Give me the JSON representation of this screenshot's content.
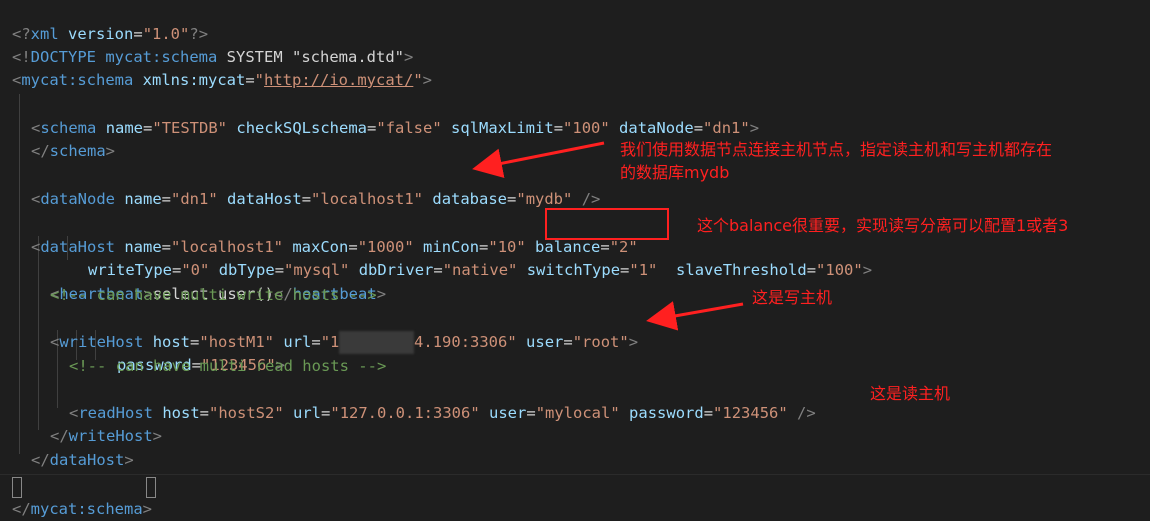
{
  "lines": {
    "l1": {
      "open": "<?",
      "name": "xml",
      "attr": "version",
      "eq": "=",
      "val": "\"1.0\"",
      "close": "?>"
    },
    "l2": {
      "open": "<!",
      "kw": "DOCTYPE",
      "name": "mycat:schema",
      "sys": "SYSTEM",
      "dtd": "\"schema.dtd\"",
      "close": ">"
    },
    "l3": {
      "open": "<",
      "name": "mycat:schema",
      "attr": "xmlns:mycat",
      "eq": "=",
      "q1": "\"",
      "url": "http://io.mycat/",
      "q2": "\"",
      "close": ">"
    },
    "schema_open": {
      "open": "<",
      "name": "schema",
      "a1": "name",
      "v1": "\"TESTDB\"",
      "a2": "checkSQLschema",
      "v2": "\"false\"",
      "a3": "sqlMaxLimit",
      "v3": "\"100\"",
      "a4": "dataNode",
      "v4": "\"dn1\"",
      "close": ">"
    },
    "schema_close": {
      "open": "</",
      "name": "schema",
      "close": ">"
    },
    "datanode": {
      "open": "<",
      "name": "dataNode",
      "a1": "name",
      "v1": "\"dn1\"",
      "a2": "dataHost",
      "v2": "\"localhost1\"",
      "a3": "database",
      "v3": "\"mydb\"",
      "close": "/>"
    },
    "datahost": {
      "open": "<",
      "name": "dataHost",
      "a1": "name",
      "v1": "\"localhost1\"",
      "a2": "maxCon",
      "v2": "\"1000\"",
      "a3": "minCon",
      "v3": "\"10\"",
      "a4": "balance",
      "v4": "\"2\""
    },
    "datahost2": {
      "a1": "writeType",
      "v1": "\"0\"",
      "a2": "dbType",
      "v2": "\"mysql\"",
      "a3": "dbDriver",
      "v3": "\"native\"",
      "a4": "switchType",
      "v4": "\"1\"",
      "a5": "slaveThreshold",
      "v5": "\"100\"",
      "close": ">"
    },
    "heartbeat": {
      "open": "<",
      "name": "heartbeat",
      "close": ">",
      "text": "select user()",
      "open2": "</",
      "name2": "heartbeat",
      "close2": ">"
    },
    "comment1": "<!-- can have multi write hosts -->",
    "writehost": {
      "open": "<",
      "name": "writeHost",
      "a1": "host",
      "v1": "\"hostM1\"",
      "a2": "url",
      "v2a": "\"1",
      "v2b": "4.190:3306\"",
      "a3": "user",
      "v3": "\"root\"",
      "close": ">"
    },
    "password": {
      "a1": "password",
      "v1": "\"123456\"",
      "close": ">"
    },
    "comment2": "<!-- can have multi read hosts -->",
    "readhost": {
      "open": "<",
      "name": "readHost",
      "a1": "host",
      "v1": "\"hostS2\"",
      "a2": "url",
      "v2": "\"127.0.0.1:3306\"",
      "a3": "user",
      "v3": "\"mylocal\"",
      "a4": "password",
      "v4": "\"123456\"",
      "close": "/>"
    },
    "writehost_close": {
      "open": "</",
      "name": "writeHost",
      "close": ">"
    },
    "datahost_close": {
      "open": "</",
      "name": "dataHost",
      "close": ">"
    },
    "mycat_close": {
      "open": "</",
      "name": "mycat:schema",
      "close": ">"
    }
  },
  "annotations": {
    "datanode_note_1": "我们使用数据节点连接主机节点，指定读主机和写主机都存在",
    "datanode_note_2": "的数据库mydb",
    "balance_note": "这个balance很重要，实现读写分离可以配置1或者3",
    "write_note": "这是写主机",
    "read_note": "这是读主机"
  },
  "colors": {
    "annotation": "#ff2020",
    "background": "#1e1e1e"
  }
}
